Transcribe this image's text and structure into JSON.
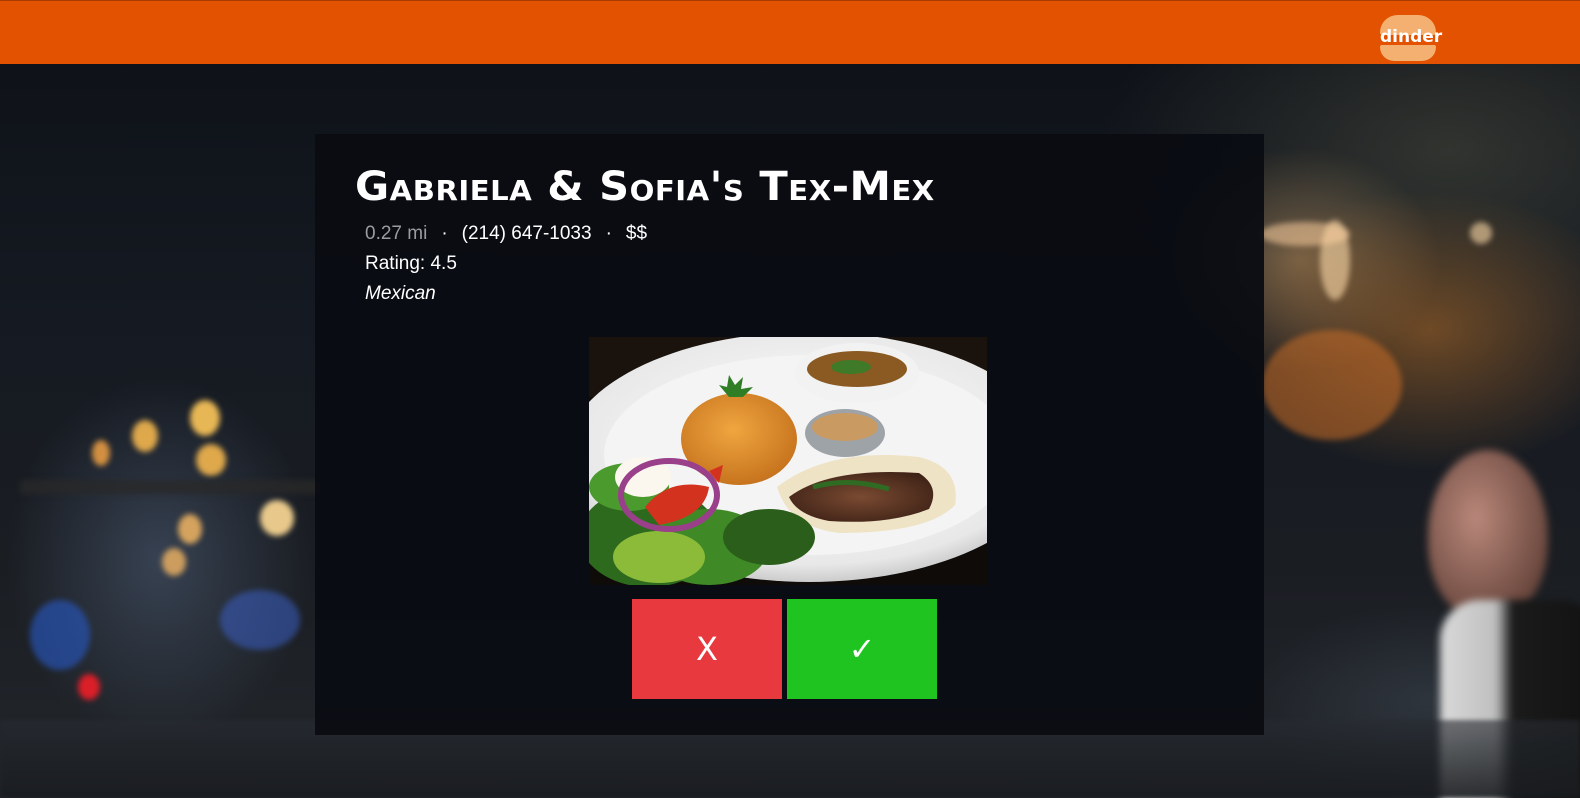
{
  "app": {
    "brand": "dinder",
    "colors": {
      "topbar": "#e35200",
      "reject": "#e8393f",
      "accept": "#1fc421"
    }
  },
  "restaurant": {
    "name": "Gabriela & Sofia's Tex-Mex",
    "distance": "0.27 mi",
    "separator": "·",
    "phone": "(214) 647-1033",
    "price": "$$",
    "rating": "Rating: 4.5",
    "cuisine": "Mexican",
    "photo_icon": "food-plate-photo"
  },
  "actions": {
    "reject_label": "X",
    "accept_label": "✓"
  }
}
